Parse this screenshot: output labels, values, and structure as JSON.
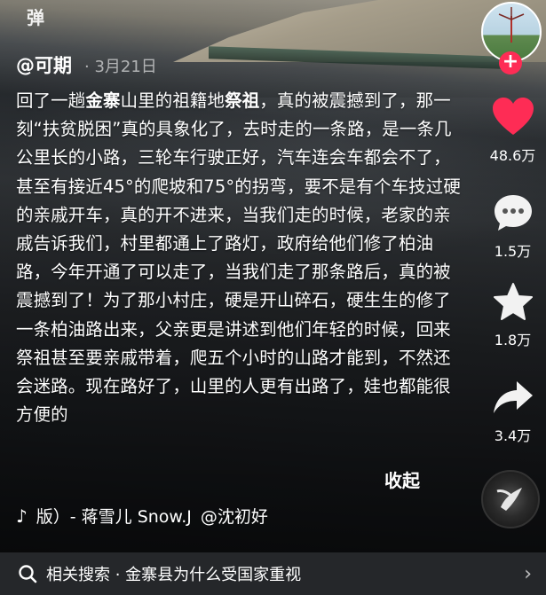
{
  "top_label": "弹",
  "author": {
    "name": "@可期",
    "date": "· 3月21日"
  },
  "description_html": "回了一趟<b>金寨</b>山里的祖籍地<b>祭祖</b>，真的被震撼到了，那一刻“扶贫脱困”真的具象化了，去时走的一条路，是一条几公里长的小路，三轮车行驶正好，汽车连会车都会不了，甚至有接近45°的爬坡和75°的拐弯，要不是有个车技过硬的亲戚开车，真的开不进来，当我们走的时候，老家的亲戚告诉我们，村里都通上了路灯，政府给他们修了柏油路，今年开通了可以走了，当我们走了那条路后，真的被震撼到了！为了那小村庄，硬是开山碎石，硬生生的修了一条柏油路出来，父亲更是讲述到他们年轻的时候，回来祭祖甚至要亲戚带着，爬五个小时的山路才能到，不然还会迷路。现在路好了，山里的人更有出路了，娃也都能很方便的",
  "collapse_label": "收起",
  "music": {
    "note": "♪",
    "title": "版）- 蒋雪儿 Snow.J",
    "artist": "@沈初好"
  },
  "actions": {
    "like": {
      "count": "48.6万"
    },
    "comment": {
      "count": "1.5万"
    },
    "favorite": {
      "count": "1.8万"
    },
    "share": {
      "count": "3.4万"
    }
  },
  "follow_symbol": "+",
  "search": {
    "text": "相关搜索 · 金寨县为什么受国家重视",
    "chevron": "›"
  },
  "colors": {
    "like": "#fe2c55",
    "follow": "#fe2c55"
  }
}
